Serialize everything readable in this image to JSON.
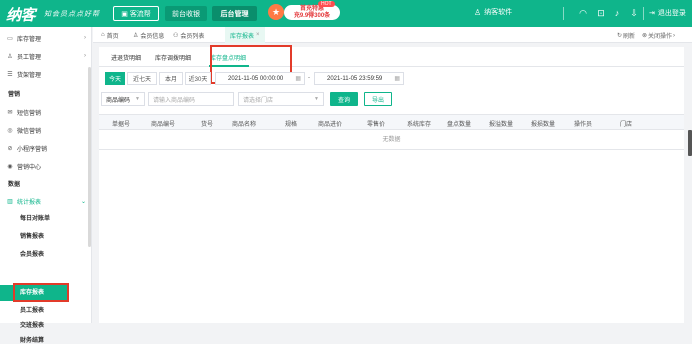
{
  "topbar": {
    "logo": "纳客",
    "slogan": "知会员点点好帮",
    "cash_register": "客流帮",
    "nav_front": "前台收银",
    "nav_back": "后台管理",
    "promo_hot": "HOT",
    "promo_line1": "首充特惠",
    "promo_line2": "充9.9得300条",
    "company": "纳客软件",
    "logout": "退出登录"
  },
  "sidebar": {
    "items": [
      {
        "label": "库存管理",
        "icon": "box-icon"
      },
      {
        "label": "员工管理",
        "icon": "user-icon"
      },
      {
        "label": "货架管理",
        "icon": "shelf-icon"
      }
    ],
    "group_marketing": "营销",
    "marketing_items": [
      {
        "label": "短信营销",
        "icon": "message-icon"
      },
      {
        "label": "微信营销",
        "icon": "wechat-icon"
      },
      {
        "label": "小程序营销",
        "icon": "miniprogram-icon"
      },
      {
        "label": "营销中心",
        "icon": "target-icon"
      }
    ],
    "group_data": "数据",
    "statistics": "统计报表",
    "sub_items": [
      "每日对账单",
      "销售报表",
      "会员报表",
      "库存报表",
      "员工报表",
      "交班报表",
      "财务结算"
    ],
    "active_index": 3
  },
  "tabbar": {
    "home": "首页",
    "tabs": [
      "会员信息",
      "会员列表",
      "库存报表"
    ],
    "refresh": "刷新",
    "close_ops": "关闭操作"
  },
  "subtabs": [
    "进退货明细",
    "库存调拨明细",
    "库存盘点明细"
  ],
  "active_subtab": 2,
  "date_range": {
    "quick": [
      "今天",
      "近七天",
      "本月",
      "近30天"
    ],
    "selected": 0,
    "start": "2021-11-05 00:00:00",
    "end": "2021-11-05 23:59:59"
  },
  "filters": {
    "product_type": "商品编码",
    "product_placeholder": "请输入商品编码",
    "store_placeholder": "请选择门店",
    "query": "查询",
    "export": "导出"
  },
  "table": {
    "headers": [
      "单据号",
      "商品编号",
      "货号",
      "商品名称",
      "规格",
      "商品进价",
      "零售价",
      "系统库存",
      "盘点数量",
      "报溢数量",
      "报损数量",
      "操作员",
      "门店"
    ],
    "empty_text": "无数据"
  },
  "colors": {
    "brand": "#0fb58b",
    "highlight_box": "#e23b2a"
  }
}
